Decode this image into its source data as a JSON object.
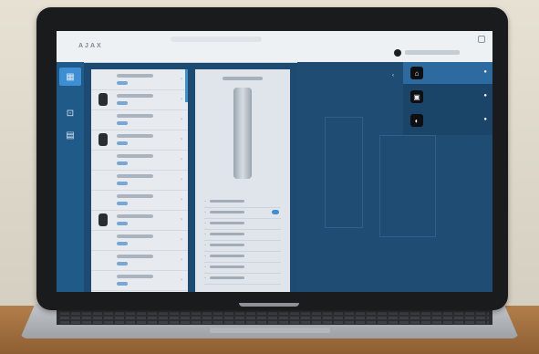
{
  "header": {
    "logo_text": "AJAX",
    "hub_label": "",
    "account_text": ""
  },
  "sidebar": {
    "items": [
      {
        "icon": "devices-icon",
        "label": "",
        "glyph": "▦",
        "active": true
      },
      {
        "icon": "rooms-icon",
        "label": "",
        "glyph": "⊡",
        "active": false
      },
      {
        "icon": "notifications-icon",
        "label": "",
        "glyph": "▤",
        "active": false
      }
    ]
  },
  "device_list": {
    "rows": 11
  },
  "device_detail": {
    "properties": 8
  },
  "hub_dropdown": {
    "items": [
      {
        "label": "",
        "glyph": "⌂",
        "active": true,
        "check": "●"
      },
      {
        "label": "",
        "glyph": "▣",
        "active": false,
        "check": "●"
      },
      {
        "label": "",
        "glyph": "◐",
        "active": false,
        "check": "●"
      }
    ],
    "chevron": "‹"
  },
  "colors": {
    "accent": "#3d8fd4",
    "sidebar": "#1f5a88",
    "background": "#1d4a70"
  }
}
